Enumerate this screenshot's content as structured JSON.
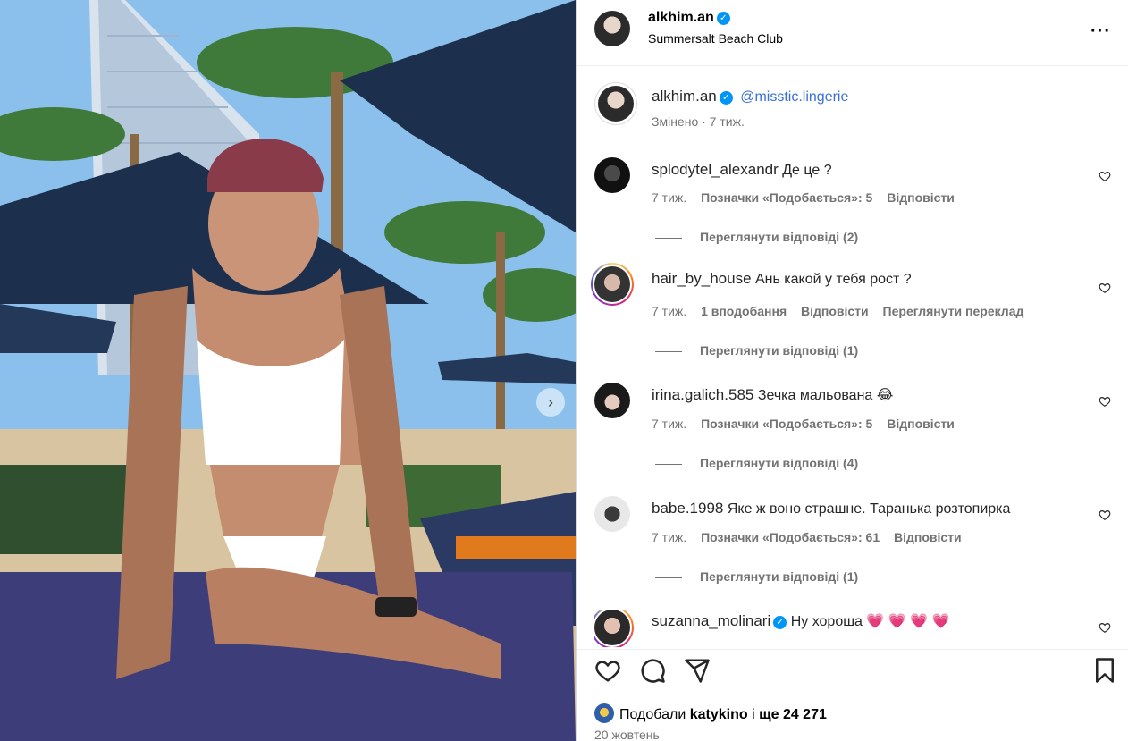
{
  "post": {
    "username": "alkhim.an",
    "location": "Summersalt Beach Club",
    "caption_mention": "@misstic.lingerie",
    "caption_meta": "Змінено · 7 тиж."
  },
  "comments": [
    {
      "username": "splodytel_alexandr",
      "text": "Де це ?",
      "time": "7 тиж.",
      "likes": "Позначки «Подобається»: 5",
      "reply": "Відповісти",
      "view_replies": "Переглянути відповіді (2)"
    },
    {
      "username": "hair_by_house",
      "text": "Ань какой у тебя рост ?",
      "time": "7 тиж.",
      "likes": "1 вподобання",
      "reply": "Відповісти",
      "translate": "Переглянути переклад",
      "view_replies": "Переглянути відповіді (1)"
    },
    {
      "username": "irina.galich.585",
      "text": "Зечка мальована 😂",
      "time": "7 тиж.",
      "likes": "Позначки «Подобається»: 5",
      "reply": "Відповісти",
      "view_replies": "Переглянути відповіді (4)"
    },
    {
      "username": "babe.1998",
      "text": "Яке ж воно страшне. Таранька розтопирка",
      "time": "7 тиж.",
      "likes": "Позначки «Подобається»: 61",
      "reply": "Відповісти",
      "view_replies": "Переглянути відповіді (1)"
    },
    {
      "username": "suzanna_molinari",
      "text": "Ну хороша 💗 💗 💗 💗"
    }
  ],
  "footer": {
    "liked_prefix": "Подобали",
    "liked_user": "katykino",
    "liked_mid": "і",
    "liked_count": "ще 24 271",
    "date": "20 жовтень"
  },
  "icons": {
    "more": "more-options-icon",
    "verified": "verified-badge-icon",
    "like": "heart-icon",
    "comment": "comment-icon",
    "share": "send-icon",
    "save": "bookmark-icon",
    "next": "chevron-right-icon"
  },
  "colors": {
    "accent": "#0095f6",
    "muted": "#737373",
    "mention": "#3a6fd8"
  }
}
